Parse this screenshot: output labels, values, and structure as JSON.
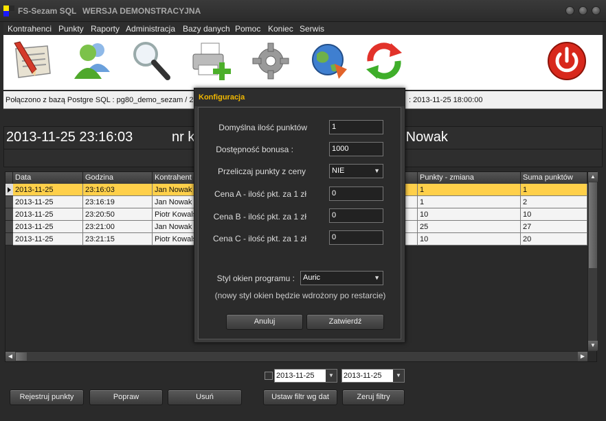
{
  "window": {
    "app_name": "FS-Sezam SQL",
    "demo_label": "WERSJA DEMONSTRACYJNA"
  },
  "menu": [
    "Kontrahenci",
    "Punkty",
    "Raporty",
    "Administracja",
    "Bazy danych",
    "Pomoc",
    "Koniec",
    "Serwis"
  ],
  "toolbar": {
    "icons": [
      "register-points-icon",
      "customers-icon",
      "search-icon",
      "print-add-icon",
      "settings-gear-icon",
      "globe-sync-icon",
      "refresh-icon",
      "power-icon"
    ]
  },
  "status": {
    "connection_text": "Połączono z bazą Postgre SQL  : pg80_demo_sezam / 22",
    "right_text": ": 2013-11-25  18:00:00"
  },
  "info": {
    "datetime": "2013-11-25 23:16:03",
    "nr_partial": "nr k",
    "name_partial": "n Nowak"
  },
  "grid": {
    "columns": [
      "Data",
      "Godzina",
      "Kontrahent",
      "Punkty - zmiana",
      "Suma punktów"
    ],
    "rows": [
      {
        "date": "2013-11-25",
        "time": "23:16:03",
        "customer": "Jan Nowak",
        "change": "1",
        "sum": "1",
        "selected": true
      },
      {
        "date": "2013-11-25",
        "time": "23:16:19",
        "customer": "Jan Nowak",
        "change": "1",
        "sum": "2",
        "selected": false
      },
      {
        "date": "2013-11-25",
        "time": "23:20:50",
        "customer": "Piotr Kowals",
        "change": "10",
        "sum": "10",
        "selected": false
      },
      {
        "date": "2013-11-25",
        "time": "23:21:00",
        "customer": "Jan Nowak",
        "change": "25",
        "sum": "27",
        "selected": false
      },
      {
        "date": "2013-11-25",
        "time": "23:21:15",
        "customer": "Piotr Kowals",
        "change": "10",
        "sum": "20",
        "selected": false
      }
    ]
  },
  "filter": {
    "date_from": "2013-11-25",
    "date_to": "2013-11-25"
  },
  "buttons": {
    "register": "Rejestruj punkty",
    "edit": "Popraw",
    "delete": "Usuń",
    "apply_filter": "Ustaw filtr wg dat",
    "reset_filter": "Zeruj filtry"
  },
  "dialog": {
    "title": "Konfiguracja",
    "fields": [
      {
        "label": "Domyślna ilość punktów",
        "value": "1"
      },
      {
        "label": "Dostępność bonusa :",
        "value": "1000"
      },
      {
        "label": "Przeliczaj punkty z ceny",
        "value": "NIE"
      },
      {
        "label": "Cena A - ilość pkt. za 1 zł",
        "value": "0"
      },
      {
        "label": "Cena B - ilość pkt. za 1 zł",
        "value": "0"
      },
      {
        "label": "Cena C - ilość pkt. za 1 zł",
        "value": "0"
      }
    ],
    "style_label": "Styl okien programu :",
    "style_value": "Auric",
    "note": "(nowy styl okien będzie wdrożony po restarcie)",
    "cancel": "Anuluj",
    "confirm": "Zatwierdź"
  },
  "colors": {
    "selected_row": "#ffd04a",
    "dialog_title": "#f2b800",
    "background": "#2a2a2a"
  }
}
